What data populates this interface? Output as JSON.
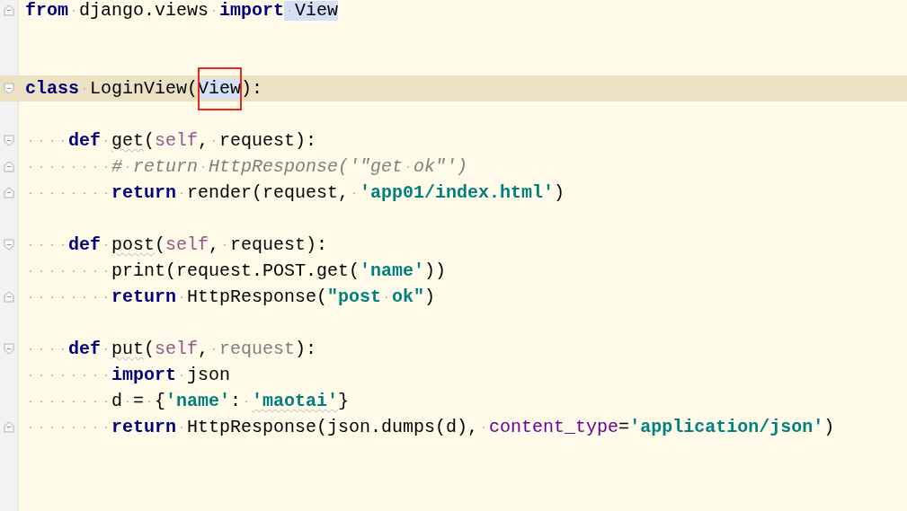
{
  "editor": {
    "lines": [
      {
        "kind": "code",
        "fold_end": true,
        "current": false,
        "tokens": [
          {
            "text": "from",
            "kind": "keyword"
          },
          {
            "text": " django.views ",
            "kind": "plain"
          },
          {
            "text": "import",
            "kind": "keyword"
          },
          {
            "text": " View",
            "kind": "plain",
            "highlight": true
          }
        ]
      },
      {
        "kind": "blank",
        "current": false
      },
      {
        "kind": "blank",
        "current": false
      },
      {
        "kind": "code",
        "fold_start": true,
        "current": true,
        "tokens": [
          {
            "text": "class",
            "kind": "keyword"
          },
          {
            "text": " LoginView(",
            "kind": "plain"
          },
          {
            "text": "V",
            "kind": "plain",
            "highlight": true,
            "caret_after": true,
            "boxed": true
          },
          {
            "text": "iew",
            "kind": "plain",
            "highlight": true,
            "boxed": true
          },
          {
            "text": "):",
            "kind": "plain"
          }
        ]
      },
      {
        "kind": "blank",
        "current": false
      },
      {
        "kind": "code",
        "fold_start": true,
        "current": false,
        "tokens": [
          {
            "text": "    def ",
            "kind": "keyword"
          },
          {
            "text": "get",
            "kind": "plain",
            "squiggle": true
          },
          {
            "text": "(",
            "kind": "plain"
          },
          {
            "text": "self",
            "kind": "self"
          },
          {
            "text": ", request):",
            "kind": "plain"
          }
        ]
      },
      {
        "kind": "code",
        "fold_end": true,
        "current": false,
        "tokens": [
          {
            "text": "        # return HttpResponse('\"get ok\"')",
            "kind": "comment"
          }
        ]
      },
      {
        "kind": "code",
        "fold_end": true,
        "current": false,
        "tokens": [
          {
            "text": "        return",
            "kind": "keyword"
          },
          {
            "text": " render(request, ",
            "kind": "plain"
          },
          {
            "text": "'app01/index.html'",
            "kind": "string"
          },
          {
            "text": ")",
            "kind": "plain"
          }
        ]
      },
      {
        "kind": "blank",
        "current": false
      },
      {
        "kind": "code",
        "fold_start": true,
        "current": false,
        "tokens": [
          {
            "text": "    def ",
            "kind": "keyword"
          },
          {
            "text": "post",
            "kind": "plain",
            "squiggle": true
          },
          {
            "text": "(",
            "kind": "plain"
          },
          {
            "text": "self",
            "kind": "self"
          },
          {
            "text": ", request):",
            "kind": "plain"
          }
        ]
      },
      {
        "kind": "code",
        "current": false,
        "tokens": [
          {
            "text": "        print(request.POST.get(",
            "kind": "plain"
          },
          {
            "text": "'name'",
            "kind": "string"
          },
          {
            "text": "))",
            "kind": "plain"
          }
        ]
      },
      {
        "kind": "code",
        "fold_end": true,
        "current": false,
        "tokens": [
          {
            "text": "        return",
            "kind": "keyword"
          },
          {
            "text": " HttpResponse(",
            "kind": "plain"
          },
          {
            "text": "\"post ok\"",
            "kind": "string"
          },
          {
            "text": ")",
            "kind": "plain"
          }
        ]
      },
      {
        "kind": "blank",
        "current": false
      },
      {
        "kind": "code",
        "fold_start": true,
        "current": false,
        "tokens": [
          {
            "text": "    def ",
            "kind": "keyword"
          },
          {
            "text": "put",
            "kind": "plain",
            "squiggle": true
          },
          {
            "text": "(",
            "kind": "plain"
          },
          {
            "text": "self",
            "kind": "self"
          },
          {
            "text": ", ",
            "kind": "plain"
          },
          {
            "text": "request",
            "kind": "unused"
          },
          {
            "text": "):",
            "kind": "plain"
          }
        ]
      },
      {
        "kind": "code",
        "current": false,
        "tokens": [
          {
            "text": "        import",
            "kind": "keyword"
          },
          {
            "text": " json",
            "kind": "plain"
          }
        ]
      },
      {
        "kind": "code",
        "current": false,
        "tokens": [
          {
            "text": "        d = {",
            "kind": "plain"
          },
          {
            "text": "'name'",
            "kind": "string"
          },
          {
            "text": ": ",
            "kind": "plain"
          },
          {
            "text": "'maotai'",
            "kind": "string",
            "squiggle": true
          },
          {
            "text": "}",
            "kind": "plain"
          }
        ]
      },
      {
        "kind": "code",
        "fold_end": true,
        "current": false,
        "tokens": [
          {
            "text": "        return",
            "kind": "keyword"
          },
          {
            "text": " HttpResponse(json.dumps(d), ",
            "kind": "plain"
          },
          {
            "text": "content_type",
            "kind": "argname"
          },
          {
            "text": "=",
            "kind": "plain"
          },
          {
            "text": "'application/json'",
            "kind": "string"
          },
          {
            "text": ")",
            "kind": "plain"
          }
        ]
      },
      {
        "kind": "blank",
        "current": false
      },
      {
        "kind": "blank",
        "current": false
      }
    ]
  }
}
